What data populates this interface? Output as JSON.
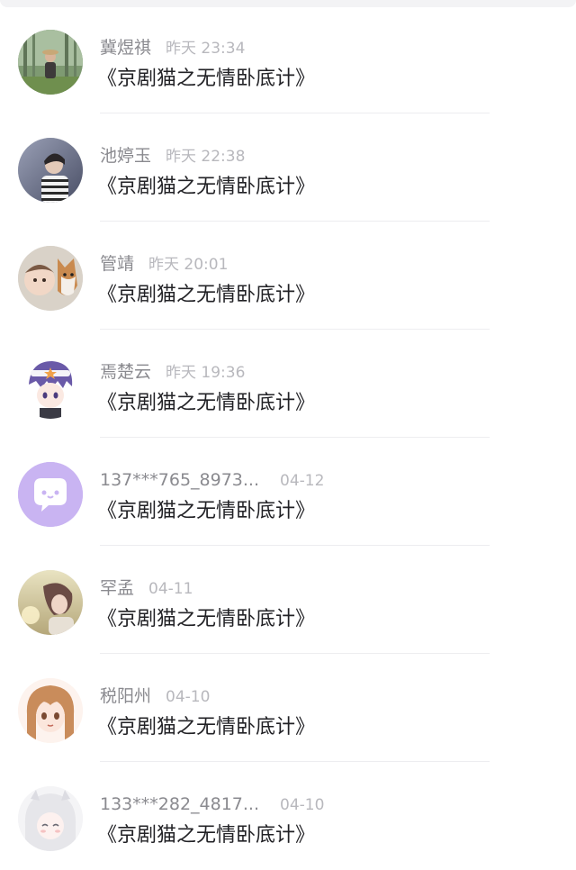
{
  "colors": {
    "name": "#8a8a8f",
    "time": "#b8b8bd",
    "title": "#222226",
    "divider": "#ededf0",
    "accent_purple": "#c9b4f2"
  },
  "items": [
    {
      "name": "冀煜祺",
      "time": "昨天 23:34",
      "title": "《京剧猫之无情卧底计》",
      "avatar": "forest-person-avatar"
    },
    {
      "name": "池婷玉",
      "time": "昨天 22:38",
      "title": "《京剧猫之无情卧底计》",
      "avatar": "striped-shirt-person-avatar"
    },
    {
      "name": "管靖",
      "time": "昨天 20:01",
      "title": "《京剧猫之无情卧底计》",
      "avatar": "baby-and-dog-avatar"
    },
    {
      "name": "焉楚云",
      "time": "昨天 19:36",
      "title": "《京剧猫之无情卧底计》",
      "avatar": "anime-boy-avatar"
    },
    {
      "name": "137***765_8973...",
      "time": "04-12",
      "title": "《京剧猫之无情卧底计》",
      "avatar": "default-chat-bubble-avatar"
    },
    {
      "name": "罕孟",
      "time": "04-11",
      "title": "《京剧猫之无情卧底计》",
      "avatar": "sunset-girl-avatar"
    },
    {
      "name": "税阳州",
      "time": "04-10",
      "title": "《京剧猫之无情卧底计》",
      "avatar": "anime-girl-avatar"
    },
    {
      "name": "133***282_4817...",
      "time": "04-10",
      "title": "《京剧猫之无情卧底计》",
      "avatar": "white-hair-anime-avatar"
    }
  ]
}
